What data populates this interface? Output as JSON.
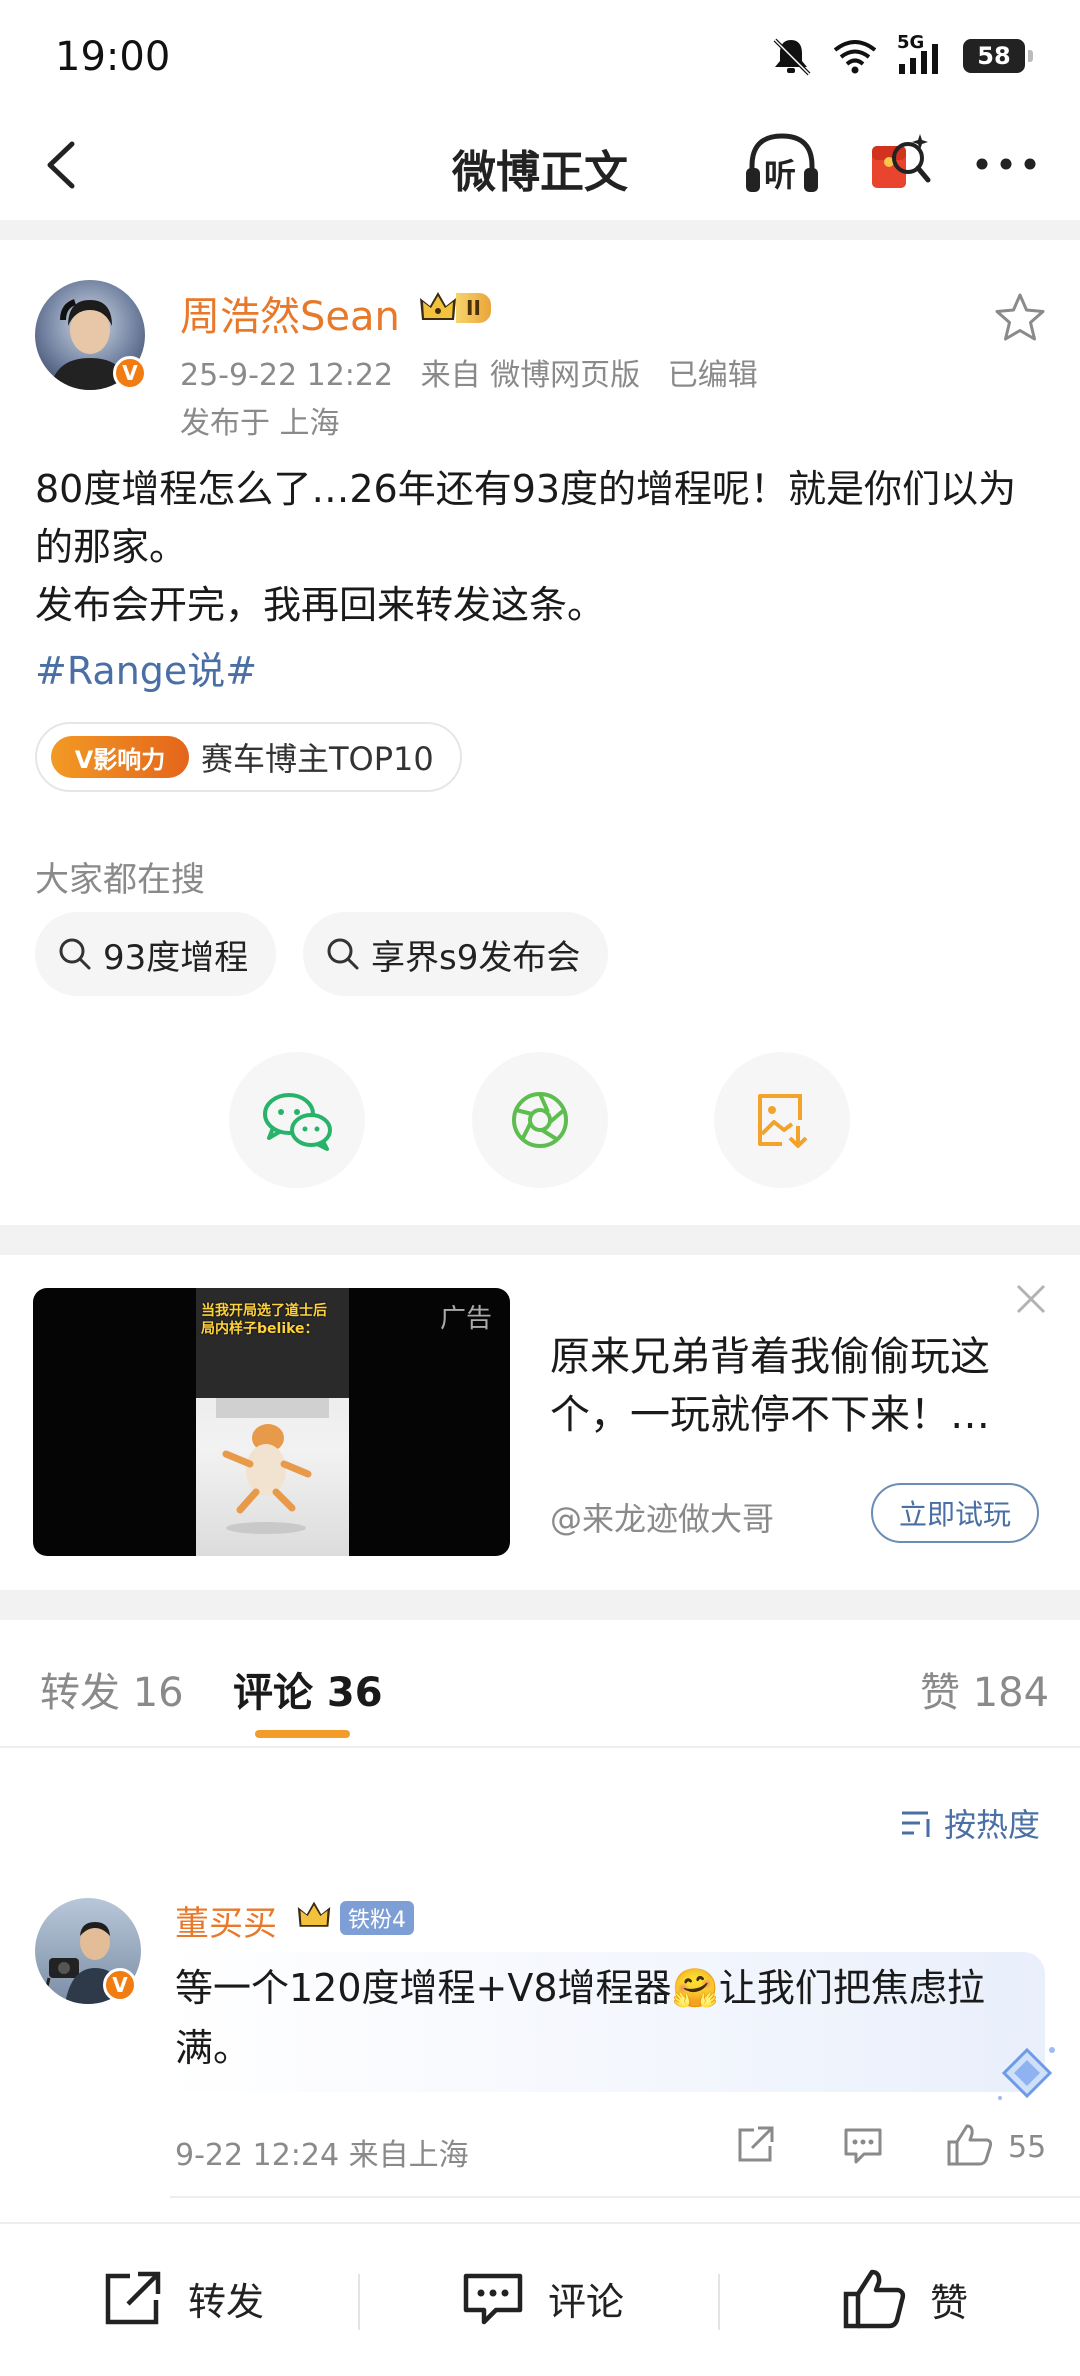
{
  "status_bar": {
    "time": "19:00",
    "network": "5G",
    "battery": "58"
  },
  "nav": {
    "title": "微博正文",
    "listen_label": "听"
  },
  "post": {
    "author": "周浩然Sean",
    "crown_level": "II",
    "verified_badge": "V",
    "time": "25-9-22 12:22",
    "source": "来自 微博网页版",
    "edited": "已编辑",
    "location": "发布于 上海",
    "text_line1": "80度增程怎么了…26年还有93度的增程呢！就是你们以为的那家。",
    "text_line2": "发布会开完，我再回来转发这条。",
    "hashtag": "#Range说#",
    "influence_tag": "V影响力",
    "influence_text": "赛车博主TOP10"
  },
  "trending": {
    "heading": "大家都在搜",
    "chips": [
      "93度增程",
      "享界s9发布会"
    ]
  },
  "ad": {
    "caption": "当我开局选了道士后\n局内样子belike：",
    "ad_tag": "广告",
    "title": "原来兄弟背着我偷偷玩这个，一玩就停不下来！…",
    "sponsor": "@来龙迹做大哥",
    "cta": "立即试玩"
  },
  "tabs": {
    "repost": "转发 16",
    "comments": "评论 36",
    "likes": "赞 184"
  },
  "sort_label": "按热度",
  "comment": {
    "author": "董买买",
    "fan_badge": "铁粉4",
    "text": "等一个120度增程+V8增程器🤗让我们把焦虑拉满。",
    "meta": "9-22 12:24  来自上海",
    "likes": "55"
  },
  "bottom_bar": {
    "repost": "转发",
    "comment": "评论",
    "like": "赞"
  },
  "colors": {
    "username": "#e8782a",
    "link": "#4a6fa5",
    "tab_indicator": "#f39c2a"
  }
}
